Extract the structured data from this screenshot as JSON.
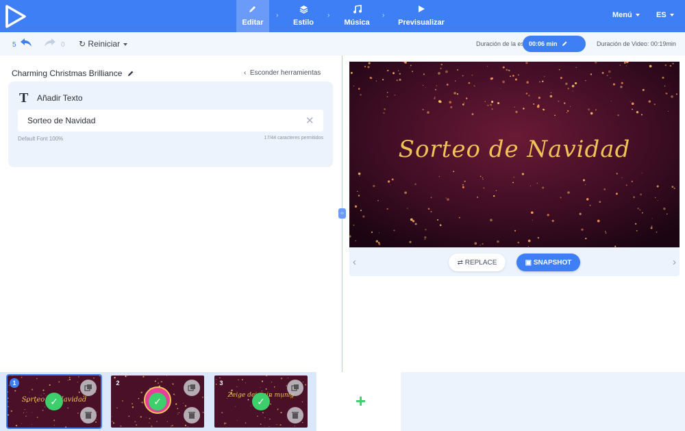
{
  "nav": {
    "items": [
      {
        "label": "Editar",
        "icon": "pencil-icon",
        "active": true
      },
      {
        "label": "Estilo",
        "icon": "layers-icon",
        "active": false
      },
      {
        "label": "Música",
        "icon": "music-icon",
        "active": false
      },
      {
        "label": "Previsualizar",
        "icon": "play-icon",
        "active": false
      }
    ],
    "menu_label": "Menú",
    "lang_label": "ES"
  },
  "toolbar": {
    "undo_count": "5",
    "redo_count": "0",
    "reset_label": "Reiniciar",
    "scene_duration_label": "Duración de la escena:",
    "scene_duration_value": "00:06 min",
    "video_duration_label": "Duración de Video: 00:19min"
  },
  "editor": {
    "project_title": "Charming Christmas Brilliance",
    "hide_tools_label": "Esconder herramientas",
    "add_text_label": "Añadir Texto",
    "text_value": "Sorteo de Navidad",
    "font_meta": "Default Font   100%",
    "char_count": "17/44 caracteres permitidos"
  },
  "preview": {
    "caption": "Sorteo de Navidad",
    "replace_label": "REPLACE",
    "snapshot_label": "SNAPSHOT"
  },
  "timeline": {
    "scenes": [
      {
        "num": "1",
        "text": "Sorteo de Navidad"
      },
      {
        "num": "2",
        "text": ""
      },
      {
        "num": "3",
        "text": "Zeige dein ein munig"
      }
    ]
  },
  "colors": {
    "accent": "#3f7ff5",
    "success": "#3ccf6b",
    "panel": "#edf3fd"
  }
}
